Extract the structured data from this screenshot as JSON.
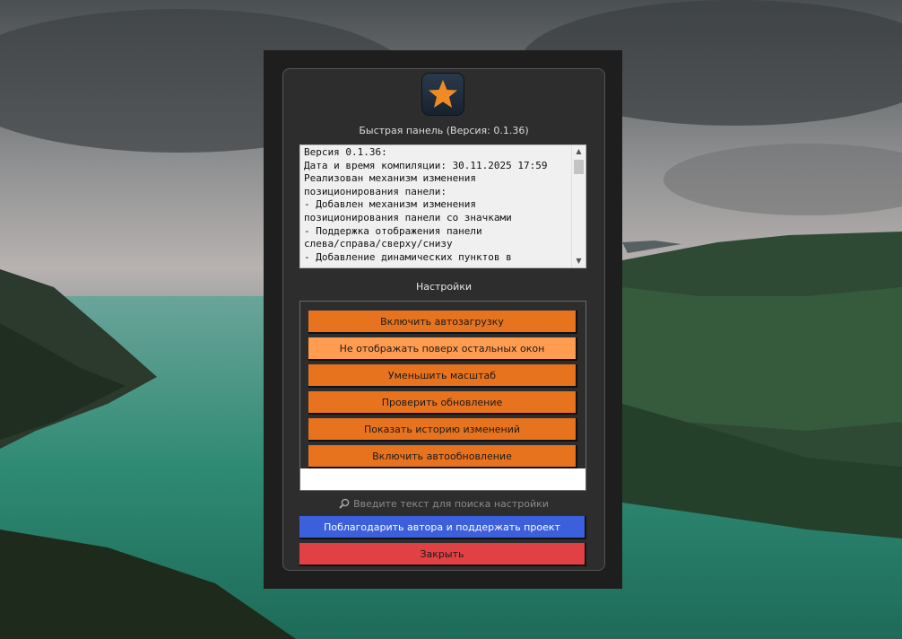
{
  "colors": {
    "orange": "#e8731f",
    "orange_light": "#ff9c4f",
    "support_blue": "#3c5fdc",
    "close_red": "#e14145",
    "star": "#f08a24"
  },
  "app": {
    "icon": "star-icon",
    "title": "Быстрая панель (Версия: 0.1.36)"
  },
  "changelog": {
    "lines": [
      "Версия 0.1.36:",
      "Дата и время компиляции: 30.11.2025 17:59",
      "Реализован механизм изменения",
      "позиционирования панели:",
      "- Добавлен механизм изменения",
      "позиционирования панели со значками",
      "- Поддержка отображения панели",
      "слева/справа/сверху/снизу",
      "- Добавление динамических пунктов в"
    ]
  },
  "settings": {
    "title": "Настройки",
    "buttons": [
      {
        "label": "Включить автозагрузку"
      },
      {
        "label": "Не отображать поверх остальных окон"
      },
      {
        "label": "Уменьшить масштаб"
      },
      {
        "label": "Проверить обновление"
      },
      {
        "label": "Показать историю изменений"
      },
      {
        "label": "Включить автообновление"
      }
    ],
    "search_placeholder": "Введите текст для поиска настройки",
    "search_icon": "magnifier-icon"
  },
  "actions": {
    "support_label": "Поблагодарить автора и поддержать проект",
    "close_label": "Закрыть"
  }
}
